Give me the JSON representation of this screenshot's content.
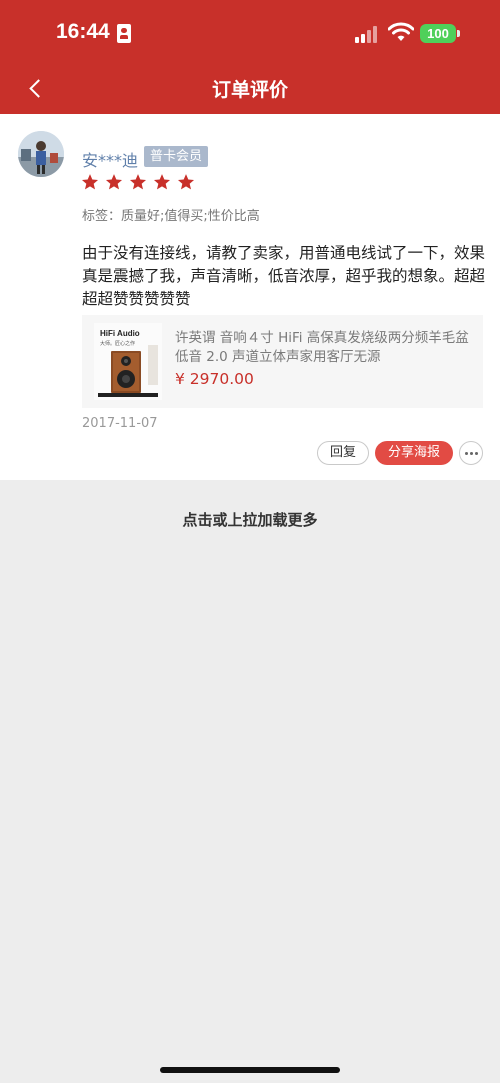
{
  "status_bar": {
    "time": "16:44",
    "battery": "100",
    "icons": [
      "id-card-icon",
      "signal-icon",
      "wifi-icon",
      "battery-icon"
    ]
  },
  "header": {
    "title": "订单评价",
    "back_icon": "chevron-left-icon"
  },
  "review": {
    "username": "安***迪",
    "member_badge": "普卡会员",
    "rating": 5,
    "star_color": "#c8302a",
    "tags": "标签：质量好;值得买;性价比高",
    "text": "由于没有连接线，请教了卖家，用普通电线试了一下，效果真是震撼了我，声音清晰，低音浓厚，超乎我的想象。超超超超赞赞赞赞赞",
    "date": "2017-11-07"
  },
  "product": {
    "name": "许英谓 音响４寸 HiFi 高保真发烧级两分频羊毛盆低音 2.0 声道立体声家用客厅无源",
    "price": "¥ 2970.00",
    "image_caption": "HiFi Audio",
    "image_subcaption": "大师。匠心之作"
  },
  "actions": {
    "reply": "回复",
    "share_poster": "分享海报",
    "more_icon": "more-dots-icon"
  },
  "footer": {
    "load_more": "点击或上拉加载更多"
  },
  "colors": {
    "brand_red": "#c8302a",
    "share_red": "#e24b44",
    "badge_blue": "#aab8cc",
    "username_blue": "#5f7faa",
    "battery_green": "#4fd05a"
  }
}
